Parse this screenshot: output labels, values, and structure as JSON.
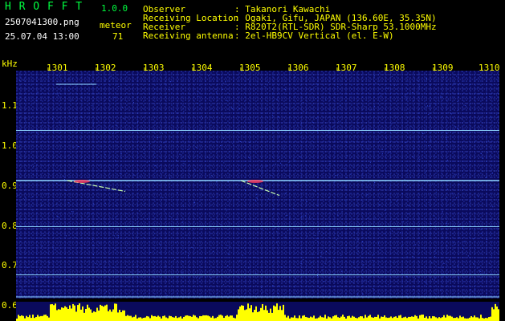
{
  "app": {
    "logo": "H R O F F T",
    "version": "1.0.0"
  },
  "file": {
    "name": "2507041300.png",
    "datetime": "25.07.04 13:00"
  },
  "meteor": {
    "label": "meteor",
    "count": "71"
  },
  "info": [
    {
      "key": "Observer",
      "value": ": Takanori Kawachi"
    },
    {
      "key": "Receiving Location",
      "value": ": Ogaki, Gifu, JAPAN (136.60E, 35.35N)"
    },
    {
      "key": "Receiver",
      "value": ": R820T2(RTL-SDR) SDR-Sharp 53.1000MHz"
    },
    {
      "key": "Receiving antenna",
      "value": ": 2el-HB9CV Vertical (el. E-W)"
    }
  ],
  "y_axis": {
    "unit": "kHz",
    "ticks": [
      "1.1",
      "1.0",
      "0.9",
      "0.8",
      "0.7",
      "0.6"
    ]
  },
  "x_axis": {
    "ticks": [
      "1301",
      "1302",
      "1303",
      "1304",
      "1305",
      "1306",
      "1307",
      "1308",
      "1309",
      "1310"
    ]
  },
  "colors": {
    "text_yellow": "#ffff00",
    "text_green": "#00ff40",
    "background": "#000000",
    "waterfall_bg": "#0a0a5c",
    "signal_line": "#8fd6ff",
    "amplitude": "#ffff00"
  },
  "chart_data": {
    "type": "heatmap",
    "xlabel": "",
    "ylabel": "kHz",
    "x_ticks": [
      "1301",
      "1302",
      "1303",
      "1304",
      "1305",
      "1306",
      "1307",
      "1308",
      "1309",
      "1310"
    ],
    "y_ticks": [
      1.1,
      1.0,
      0.9,
      0.8,
      0.7,
      0.6
    ],
    "ylim": [
      0.6,
      1.15
    ],
    "horizontal_carriers_khz": [
      1.15,
      1.035,
      0.91,
      0.795,
      0.675,
      0.62
    ],
    "meteor_streaks": [
      {
        "start_min": 1301.4,
        "end_min": 1302.6,
        "khz_start": 0.91,
        "khz_end": 0.895
      },
      {
        "start_min": 1305.0,
        "end_min": 1305.8,
        "khz_start": 0.91,
        "khz_end": 0.885
      }
    ]
  }
}
